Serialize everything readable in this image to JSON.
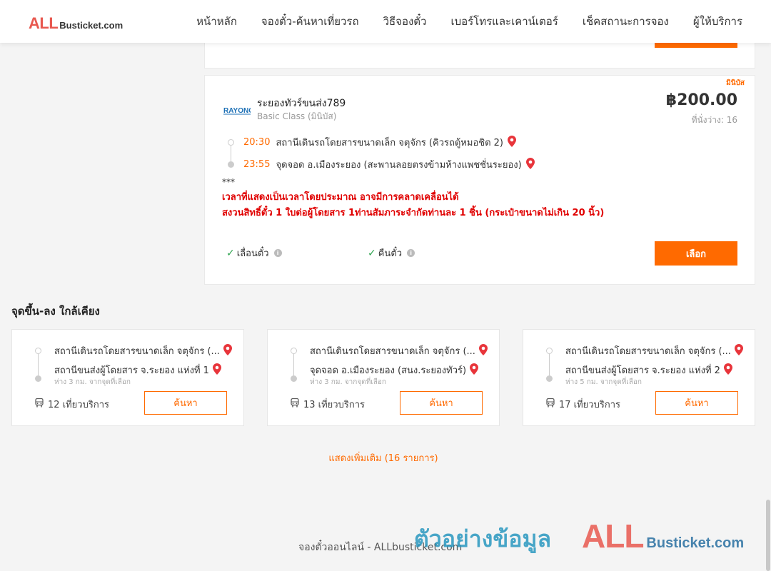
{
  "header": {
    "logo_all": "ALL",
    "logo_rest": "Busticket.com",
    "nav": [
      "หน้าหลัก",
      "จองตั๋ว-ค้นหาเที่ยวรถ",
      "วิธีจองตั๋ว",
      "เบอร์โทรและเคาน์เตอร์",
      "เช็คสถานะการจอง",
      "ผู้ให้บริการ"
    ]
  },
  "trip": {
    "tag": "มินิบัส",
    "operator_logo_text": "RAYONG",
    "operator_name": "ระยองทัวร์ขนส่ง789",
    "class": "Basic Class (มินิบัส)",
    "price": "฿200.00",
    "seats": "ที่นั่งว่าง: 16",
    "depart_time": "20:30",
    "depart_place": "สถานีเดินรถโดยสารขนาดเล็ก จตุจักร (คิวรถตู้หมอชิต 2)",
    "arrive_time": "23:55",
    "arrive_place": "จุดจอด อ.เมืองระยอง (สะพานลอยตรงข้ามห้างแพชชั่นระยอง)",
    "note_stars": "***",
    "note_line1": "เวลาที่แสดงเป็นเวลาโดยประมาณ อาจมีการคลาดเคลื่อนได้",
    "note_line2": "สงวนสิทธิ์ตั๋ว 1 ใบต่อผู้โดยสาร 1ท่านสัมภาระจำกัดท่านละ 1 ชิ้น (กระเป๋าขนาดไม่เกิน 20 นิ้ว)",
    "feature_change": "เลื่อนตั๋ว",
    "feature_refund": "คืนตั๋ว",
    "select_label": "เลือก"
  },
  "nearby": {
    "title": "จุดขึ้น-ลง ใกล้เคียง",
    "cards": [
      {
        "from": "สถานีเดินรถโดยสารขนาดเล็ก จตุจักร (...",
        "to": "สถานีขนส่งผู้โดยสาร จ.ระยอง แห่งที่ 1",
        "distance": "ห่าง 3 กม. จากจุดที่เลือก",
        "trips": "12 เที่ยวบริการ",
        "button": "ค้นหา"
      },
      {
        "from": "สถานีเดินรถโดยสารขนาดเล็ก จตุจักร (...",
        "to": "จุดจอด อ.เมืองระยอง (สนง.ระยองทัวร์)",
        "distance": "ห่าง 3 กม. จากจุดที่เลือก",
        "trips": "13 เที่ยวบริการ",
        "button": "ค้นหา"
      },
      {
        "from": "สถานีเดินรถโดยสารขนาดเล็ก จตุจักร (...",
        "to": "สถานีขนส่งผู้โดยสาร จ.ระยอง แห่งที่ 2",
        "distance": "ห่าง 5 กม. จากจุดที่เลือก",
        "trips": "17 เที่ยวบริการ",
        "button": "ค้นหา"
      }
    ],
    "show_more": "แสดงเพิ่มเติม (16 รายการ)"
  },
  "footer": {
    "text": "จองตั๋วออนไลน์ - ALLbusticket.com"
  },
  "watermark": {
    "text": "ตัวอย่างข้อมูล",
    "logo_all": "ALL",
    "logo_rest": "Busticket.com"
  },
  "colors": {
    "accent": "#ff6a00",
    "alert": "#e00000",
    "check": "#2ea44f",
    "pin": "#e8353b"
  }
}
